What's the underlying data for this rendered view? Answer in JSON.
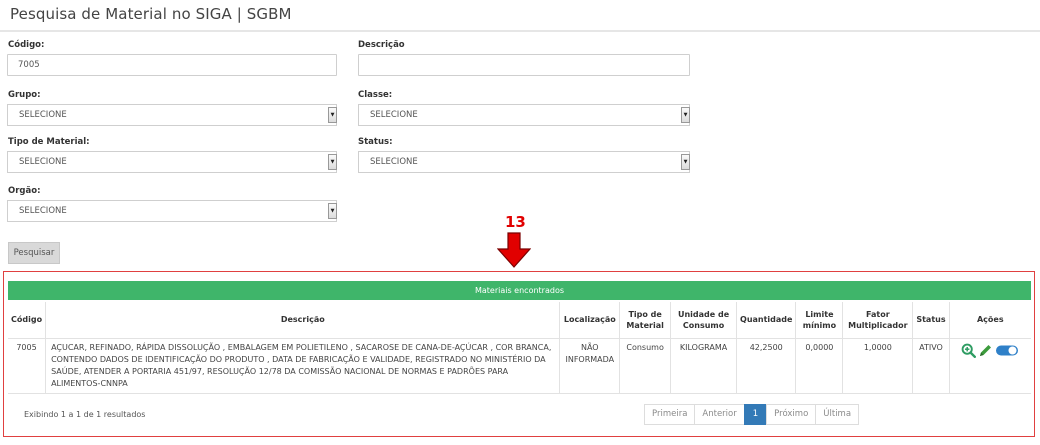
{
  "page": {
    "title": "Pesquisa de Material no SIGA | SGBM"
  },
  "form": {
    "codigo": {
      "label": "Código:",
      "value": "7005"
    },
    "descricao": {
      "label": "Descrição",
      "value": ""
    },
    "grupo": {
      "label": "Grupo:",
      "selected": "SELECIONE"
    },
    "classe": {
      "label": "Classe:",
      "selected": "SELECIONE"
    },
    "tipo_material": {
      "label": "Tipo de Material:",
      "selected": "SELECIONE"
    },
    "status": {
      "label": "Status:",
      "selected": "SELECIONE"
    },
    "orgao": {
      "label": "Orgão:",
      "selected": "SELECIONE"
    },
    "search_button": "Pesquisar"
  },
  "annotation": {
    "number": "13",
    "color": "#e10000"
  },
  "results": {
    "title": "Materiais encontrados",
    "header_color": "#3fb56a",
    "columns": [
      "Código",
      "Descrição",
      "Localização",
      "Tipo de Material",
      "Unidade de Consumo",
      "Quantidade",
      "Limite mínimo",
      "Fator Multiplicador",
      "Status",
      "Ações"
    ],
    "rows": [
      {
        "codigo": "7005",
        "descricao": "AÇUCAR, REFINADO, RÁPIDA DISSOLUÇÃO , EMBALAGEM EM POLIETILENO , SACAROSE DE CANA-DE-AÇÚCAR , COR BRANCA, CONTENDO DADOS DE IDENTIFICAÇÃO DO PRODUTO , DATA DE FABRICAÇÃO E VALIDADE, REGISTRADO NO MINISTÉRIO DA SAÚDE, ATENDER A PORTARIA 451/97, RESOLUÇÃO 12/78 DA COMISSÃO NACIONAL DE NORMAS E PADRÕES PARA ALIMENTOS-CNNPA",
        "localizacao": "NÃO INFORMADA",
        "tipo_material": "Consumo",
        "unidade_consumo": "KILOGRAMA",
        "quantidade": "42,2500",
        "limite_minimo": "0,0000",
        "fator_multiplicador": "1,0000",
        "status": "ATIVO",
        "actions": [
          "zoom-in-icon",
          "edit-pencil-icon",
          "toggle-switch-icon"
        ]
      }
    ],
    "summary": "Exibindo 1 a 1 de 1 resultados",
    "pagination": {
      "first": "Primeira",
      "prev": "Anterior",
      "current": "1",
      "next": "Próximo",
      "last": "Última"
    }
  }
}
